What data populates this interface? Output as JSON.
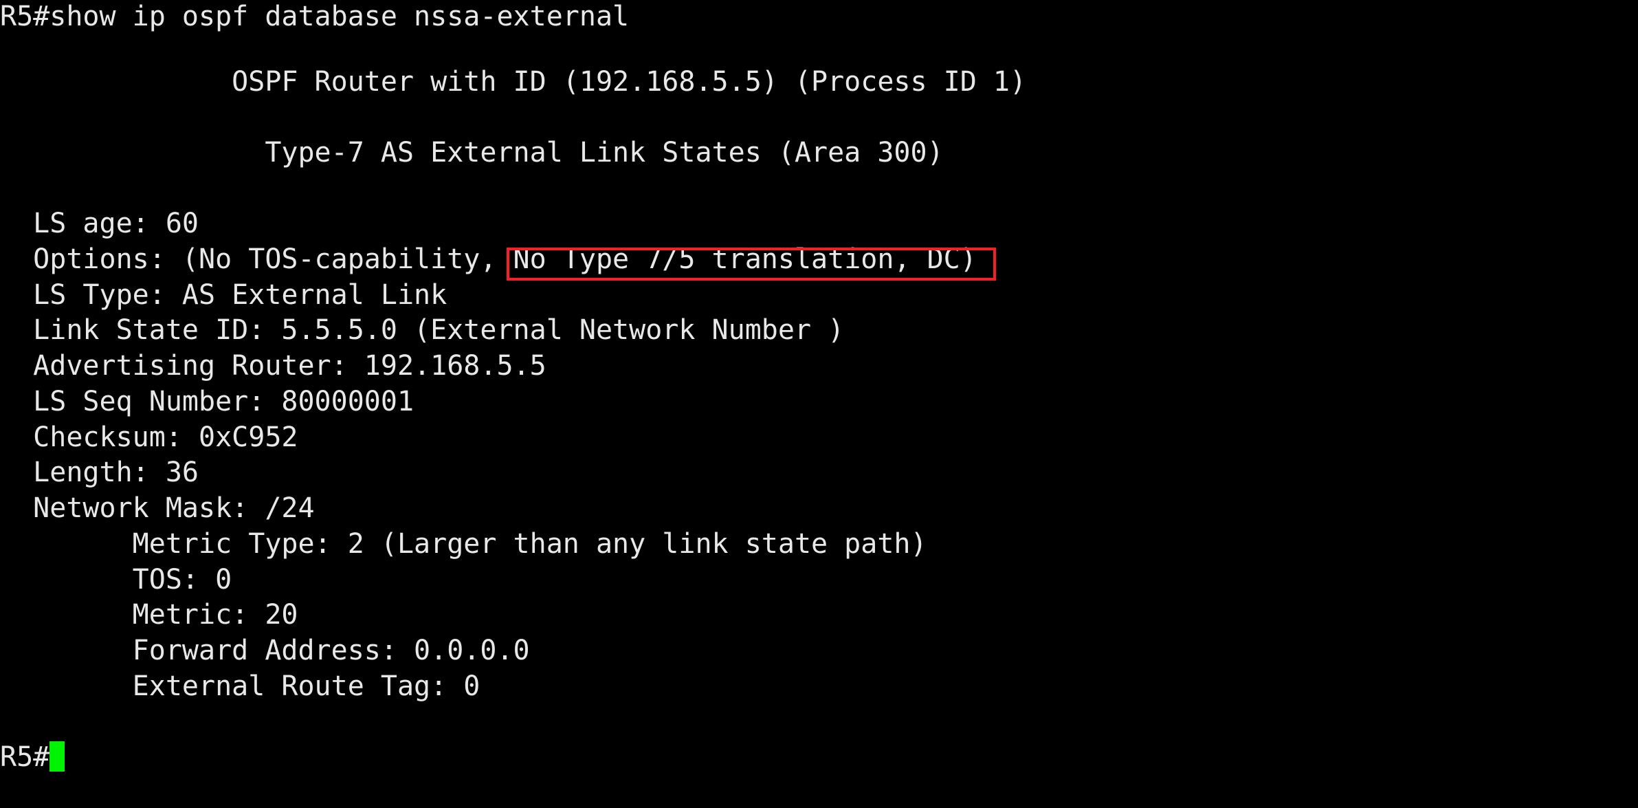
{
  "terminal": {
    "background_color": "#000000",
    "text_color": "#e8e8e8",
    "cursor_color": "#00f300",
    "highlight_color": "#f42025",
    "command_line": "R5#show ip ospf database nssa-external",
    "header": {
      "router_line": "              OSPF Router with ID (192.168.5.5) (Process ID 1)",
      "section_line": "                Type-7 AS External Link States (Area 300)"
    },
    "lsa": {
      "ls_age": "  LS age: 60",
      "options_prefix": "  Options: (No TOS-capability, ",
      "options_highlighted": "No Type 7/5 translation, DC)",
      "ls_type": "  LS Type: AS External Link",
      "link_state_id": "  Link State ID: 5.5.5.0 (External Network Number )",
      "advertising_router": "  Advertising Router: 192.168.5.5",
      "ls_seq_number": "  LS Seq Number: 80000001",
      "checksum": "  Checksum: 0xC952",
      "length": "  Length: 36",
      "network_mask": "  Network Mask: /24",
      "metric_type": "        Metric Type: 2 (Larger than any link state path)",
      "tos": "        TOS: 0",
      "metric": "        Metric: 20",
      "forward_address": "        Forward Address: 0.0.0.0",
      "external_route_tag": "        External Route Tag: 0"
    },
    "prompt": {
      "text": "R5#"
    }
  }
}
